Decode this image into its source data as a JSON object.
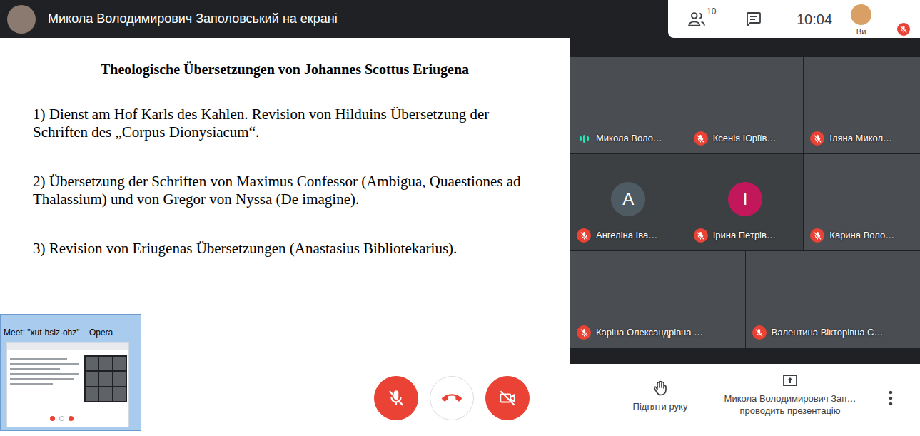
{
  "top_bar": {
    "title": "Микола Володимирович Заполовський на екрані",
    "participants_count": "10",
    "time": "10:04",
    "self_label": "Ви",
    "self_muted": true
  },
  "slide": {
    "title": "Theologische Übersetzungen von Johannes Scottus Eriugena",
    "items": [
      "1) Dienst am Hof Karls des Kahlen. Revision von Hilduins Übersetzung der Schriften des „Corpus Dionysiacum“.",
      "2) Übersetzung der Schriften von Maximus Confessor (Ambigua, Quaestiones ad Thalassium) und von Gregor von Nyssa (De imagine).",
      "3) Revision von Eriugenas Übersetzungen (Anastasius Bibliotekarius)."
    ]
  },
  "tiles": [
    {
      "name": "Микола Воло…",
      "kind": "video",
      "muted": false,
      "speaking": true
    },
    {
      "name": "Ксенія Юріїв…",
      "kind": "video",
      "muted": true,
      "speaking": false
    },
    {
      "name": "Іляна Микол…",
      "kind": "video",
      "muted": true,
      "speaking": false
    },
    {
      "name": "Ангеліна Іва…",
      "kind": "avatar",
      "initial": "А",
      "color": "#4f5b62",
      "muted": true,
      "speaking": false
    },
    {
      "name": "Ірина Петрів…",
      "kind": "avatar",
      "initial": "І",
      "color": "#c2185b",
      "muted": true,
      "speaking": false
    },
    {
      "name": "Карина Воло…",
      "kind": "video",
      "muted": true,
      "speaking": false
    },
    {
      "name": "Каріна Олександрівна …",
      "kind": "video",
      "muted": true,
      "speaking": false
    },
    {
      "name": "Валентина Вікторівна С…",
      "kind": "video",
      "muted": true,
      "speaking": false
    }
  ],
  "pip_window": {
    "title": "Meet: \"xut-hsiz-ohz\" – Opera"
  },
  "controls": {
    "mic_muted": true,
    "camera_off": true,
    "raise_hand": "Підняти руку",
    "presenter": "Микола Володимирович Зап…",
    "presenter_status": "проводить презентацію"
  }
}
